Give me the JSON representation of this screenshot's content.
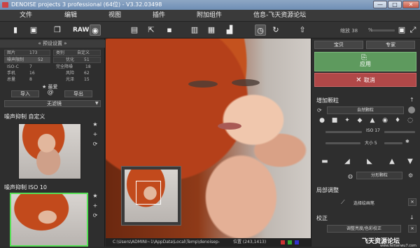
{
  "window": {
    "title": "DENOISE projects 3 professional (64位) - V3.32.03498",
    "min": "—",
    "max": "□",
    "close": "✕"
  },
  "menu": [
    "文件",
    "编辑",
    "视图",
    "插件",
    "附加组件",
    "信息-飞天资源论坛"
  ],
  "toolbar": {
    "raw_label": "RAW",
    "zoom_value": "缩放 38",
    "zoom_unit": "%"
  },
  "left": {
    "header": "预设设置",
    "stats": [
      {
        "label": "图片",
        "value": "173"
      },
      {
        "label": "类别",
        "value": "自定义"
      },
      {
        "label": "噪声限制",
        "value": "52"
      },
      {
        "label": "优化",
        "value": "51"
      },
      {
        "label": "ISO-C",
        "value": "7"
      },
      {
        "label": "完全降噪",
        "value": "18"
      },
      {
        "label": "手机",
        "value": "16"
      },
      {
        "label": "风险",
        "value": "62"
      },
      {
        "label": "总量",
        "value": "8"
      },
      {
        "label": "光泽",
        "value": "15"
      }
    ],
    "fav": "最爱",
    "import_label": "导入",
    "export_label": "导出",
    "at_label": "@",
    "filter_value": "无滤镜",
    "preset1_title": "噪声抑制 自定义",
    "preset2_title": "噪声抑制 ISO 10"
  },
  "canvas": {
    "status_path": "C:\\Users\\ADMINI~1\\AppData\\Local\\Temp\\denoisep-",
    "status_coords": "位置 (243,1413)"
  },
  "right": {
    "tab1": "宝贝",
    "tab2": "专家",
    "apply": "应用",
    "cancel": "取消",
    "add_grain": "增加颗粒",
    "grain_type": "自然颗粒",
    "iso_value": "ISO 17",
    "size_label": "大小 5",
    "grain_option": "分形颗粒",
    "local_adjust": "局部调整",
    "select_brush": "选择绘画笔",
    "correction": "校正",
    "correction_value": "调整亮度/色彩校正",
    "watermark": "飞天资源论坛",
    "watermark_url": "www.feitianwu7.com"
  },
  "colors": {
    "apply_green": "#5e9a5e",
    "cancel_red": "#b04848",
    "title_blue": "#7d99bb",
    "selected_thumb": "#55e055"
  }
}
